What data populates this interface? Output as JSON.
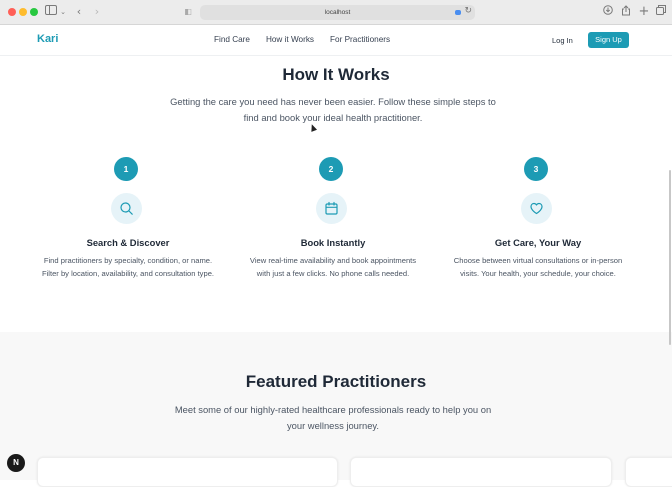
{
  "browser": {
    "url": "localhost",
    "icons": {
      "sidebar": "sidebar-icon",
      "chevron": "chevron-down-icon",
      "back": "back-icon",
      "forward": "forward-icon",
      "shield": "shield-icon",
      "reload": "reload-icon",
      "download": "download-icon",
      "share": "share-icon",
      "new_tab": "plus-icon",
      "tabs": "tabs-icon"
    }
  },
  "header": {
    "logo": "Kari",
    "nav": [
      "Find Care",
      "How it Works",
      "For Practitioners"
    ],
    "login": "Log In",
    "signup": "Sign Up"
  },
  "how_it_works": {
    "title": "How It Works",
    "subtitle": "Getting the care you need has never been easier. Follow these simple steps to find and book your ideal health practitioner.",
    "steps": [
      {
        "number": "1",
        "icon": "search-icon",
        "title": "Search & Discover",
        "description": "Find practitioners by specialty, condition, or name. Filter by location, availability, and consultation type."
      },
      {
        "number": "2",
        "icon": "calendar-icon",
        "title": "Book Instantly",
        "description": "View real-time availability and book appointments with just a few clicks. No phone calls needed."
      },
      {
        "number": "3",
        "icon": "heart-icon",
        "title": "Get Care, Your Way",
        "description": "Choose between virtual consultations or in-person visits. Your health, your schedule, your choice."
      }
    ]
  },
  "featured": {
    "title": "Featured Practitioners",
    "subtitle": "Meet some of our highly-rated healthcare professionals ready to help you on your wellness journey."
  },
  "badge": "N",
  "colors": {
    "accent": "#1d9bb4",
    "icon_bg": "#e6f3f8",
    "featured_bg": "#f8f8f8"
  }
}
